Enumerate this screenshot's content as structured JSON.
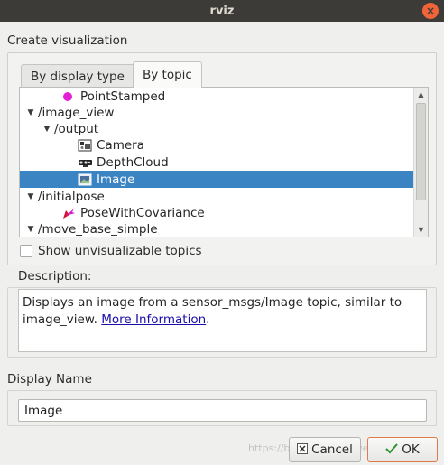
{
  "window": {
    "title": "rviz",
    "close_glyph": "×"
  },
  "create_visualization": {
    "label": "Create visualization",
    "tabs": [
      {
        "label": "By display type",
        "active": false
      },
      {
        "label": "By topic",
        "active": true
      }
    ],
    "tree": [
      {
        "label": "PointStamped",
        "icon": "point-stamped-icon",
        "level": 3
      },
      {
        "label": "/image_view",
        "icon": "",
        "level": 0,
        "expanded": true
      },
      {
        "label": "/output",
        "icon": "",
        "level": 1,
        "expanded": true
      },
      {
        "label": "Camera",
        "icon": "camera-icon",
        "level": 3
      },
      {
        "label": "DepthCloud",
        "icon": "depth-cloud-icon",
        "level": 3
      },
      {
        "label": "Image",
        "icon": "image-icon",
        "level": 3,
        "selected": true
      },
      {
        "label": "/initialpose",
        "icon": "",
        "level": 0,
        "expanded": true
      },
      {
        "label": "PoseWithCovariance",
        "icon": "pose-with-covariance-icon",
        "level": 3
      },
      {
        "label": "/move_base_simple",
        "icon": "",
        "level": 0,
        "expanded": true
      }
    ],
    "show_unvisualizable": {
      "label": "Show unvisualizable topics",
      "checked": false
    }
  },
  "description": {
    "label": "Description:",
    "text": "Displays an image from a sensor_msgs/Image topic, similar to image_view.",
    "link": "More Information",
    "trailing": "."
  },
  "display_name": {
    "label": "Display Name",
    "value": "Image"
  },
  "buttons": {
    "cancel": "Cancel",
    "ok": "OK"
  },
  "watermark": "https://blog.csdn.net/weixin_...",
  "colors": {
    "selection": "#3b84c4",
    "accent": "#e07a4a"
  }
}
